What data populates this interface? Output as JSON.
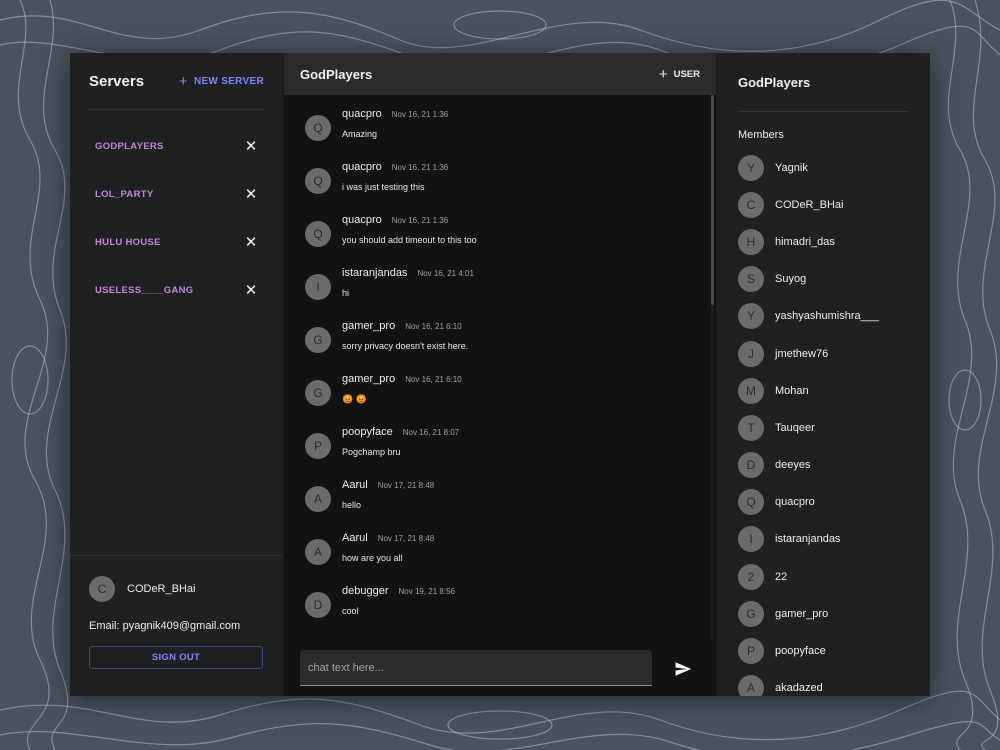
{
  "left": {
    "title": "Servers",
    "new_server_icon": "plus-icon",
    "new_server_label": "NEW SERVER",
    "servers": [
      {
        "name": "GODPLAYERS"
      },
      {
        "name": "LOL_PARTY"
      },
      {
        "name": "HULU HOUSE"
      },
      {
        "name": "USELESS____GANG"
      }
    ],
    "profile": {
      "avatar": "C",
      "name": "CODeR_BHai",
      "email": "Email: pyagnik409@gmail.com",
      "signout_label": "SIGN OUT"
    }
  },
  "chat": {
    "title": "GodPlayers",
    "add_user_label": "USER",
    "messages": [
      {
        "avatar": "Q",
        "author": "quacpro",
        "time": "Nov 16, 21 1:36",
        "text": "Amazing"
      },
      {
        "avatar": "Q",
        "author": "quacpro",
        "time": "Nov 16, 21 1:36",
        "text": "i was just testing this"
      },
      {
        "avatar": "Q",
        "author": "quacpro",
        "time": "Nov 16, 21 1:36",
        "text": "you should add timeout to this too"
      },
      {
        "avatar": "I",
        "author": "istaranjandas",
        "time": "Nov 16, 21 4:01",
        "text": "hi"
      },
      {
        "avatar": "G",
        "author": "gamer_pro",
        "time": "Nov 16, 21 6:10",
        "text": "sorry privacy doesn't exist here."
      },
      {
        "avatar": "G",
        "author": "gamer_pro",
        "time": "Nov 16, 21 6:10",
        "text": "😡 😡"
      },
      {
        "avatar": "P",
        "author": "poopyface",
        "time": "Nov 16, 21 8:07",
        "text": "Pogchamp bru"
      },
      {
        "avatar": "A",
        "author": "Aarul",
        "time": "Nov 17, 21 8:48",
        "text": "hello"
      },
      {
        "avatar": "A",
        "author": "Aarul",
        "time": "Nov 17, 21 8:48",
        "text": "how are you all"
      },
      {
        "avatar": "D",
        "author": "debugger",
        "time": "Nov 19, 21 8:56",
        "text": "cool"
      }
    ],
    "input_placeholder": "chat text here...",
    "send_icon": "send-icon"
  },
  "right": {
    "title": "GodPlayers",
    "members_label": "Members",
    "members": [
      {
        "avatar": "Y",
        "name": "Yagnik"
      },
      {
        "avatar": "C",
        "name": "CODeR_BHai"
      },
      {
        "avatar": "H",
        "name": "himadri_das"
      },
      {
        "avatar": "S",
        "name": "Suyog"
      },
      {
        "avatar": "Y",
        "name": "yashyashumishra___"
      },
      {
        "avatar": "J",
        "name": "jmethew76"
      },
      {
        "avatar": "M",
        "name": "Mohan"
      },
      {
        "avatar": "T",
        "name": "Tauqeer"
      },
      {
        "avatar": "D",
        "name": "deeyes"
      },
      {
        "avatar": "Q",
        "name": "quacpro"
      },
      {
        "avatar": "I",
        "name": "istaranjandas"
      },
      {
        "avatar": "2",
        "name": "22"
      },
      {
        "avatar": "G",
        "name": "gamer_pro"
      },
      {
        "avatar": "P",
        "name": "poopyface"
      },
      {
        "avatar": "A",
        "name": "akadazed"
      }
    ]
  },
  "colors": {
    "accent": "#7f86f6",
    "server_name": "#c985dc",
    "panel": "#1f2021",
    "chat_bg": "#121212",
    "page_bg": "#4a525e"
  }
}
